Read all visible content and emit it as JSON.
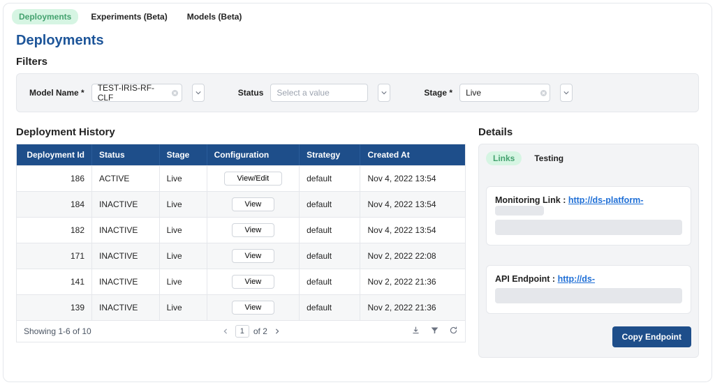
{
  "nav": {
    "tabs": [
      {
        "label": "Deployments",
        "active": true
      },
      {
        "label": "Experiments (Beta)",
        "active": false
      },
      {
        "label": "Models (Beta)",
        "active": false
      }
    ]
  },
  "page_title": "Deployments",
  "filters": {
    "heading": "Filters",
    "model_name": {
      "label": "Model Name *",
      "value": "TEST-IRIS-RF-CLF"
    },
    "status": {
      "label": "Status",
      "placeholder": "Select a value",
      "value": ""
    },
    "stage": {
      "label": "Stage *",
      "value": "Live"
    }
  },
  "history": {
    "heading": "Deployment History",
    "columns": [
      "Deployment Id",
      "Status",
      "Stage",
      "Configuration",
      "Strategy",
      "Created At"
    ],
    "rows": [
      {
        "id": "186",
        "status": "ACTIVE",
        "stage": "Live",
        "config": "View/Edit",
        "strategy": "default",
        "created": "Nov 4, 2022 13:54"
      },
      {
        "id": "184",
        "status": "INACTIVE",
        "stage": "Live",
        "config": "View",
        "strategy": "default",
        "created": "Nov 4, 2022 13:54"
      },
      {
        "id": "182",
        "status": "INACTIVE",
        "stage": "Live",
        "config": "View",
        "strategy": "default",
        "created": "Nov 4, 2022 13:54"
      },
      {
        "id": "171",
        "status": "INACTIVE",
        "stage": "Live",
        "config": "View",
        "strategy": "default",
        "created": "Nov 2, 2022 22:08"
      },
      {
        "id": "141",
        "status": "INACTIVE",
        "stage": "Live",
        "config": "View",
        "strategy": "default",
        "created": "Nov 2, 2022 21:36"
      },
      {
        "id": "139",
        "status": "INACTIVE",
        "stage": "Live",
        "config": "View",
        "strategy": "default",
        "created": "Nov 2, 2022 21:36"
      }
    ],
    "footer": {
      "range": "Showing 1-6 of 10",
      "page": "1",
      "of_label": "of 2"
    }
  },
  "details": {
    "heading": "Details",
    "tabs": [
      {
        "label": "Links",
        "active": true
      },
      {
        "label": "Testing",
        "active": false
      }
    ],
    "monitoring": {
      "label": "Monitoring Link : ",
      "link_text": "http://ds-platform-"
    },
    "api": {
      "label": "API Endpoint : ",
      "link_text": "http://ds-"
    },
    "copy_label": "Copy Endpoint"
  }
}
